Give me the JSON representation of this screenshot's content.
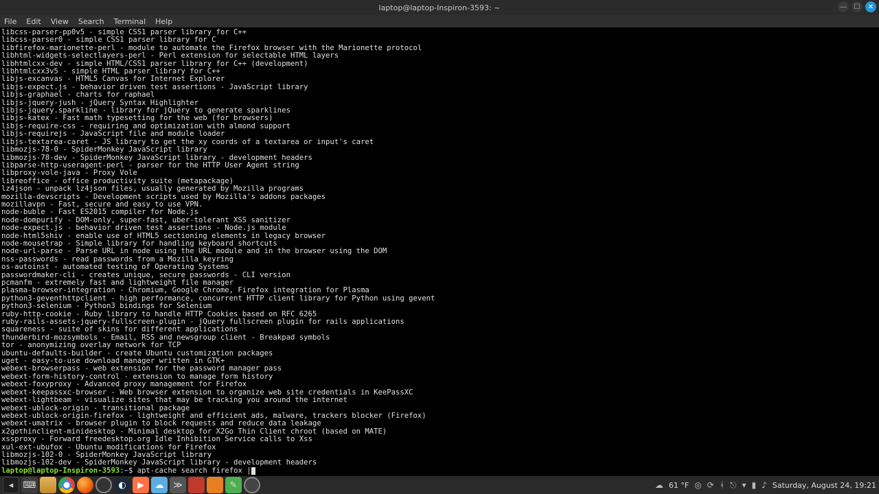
{
  "window": {
    "title": "laptop@laptop-Inspiron-3593: ~"
  },
  "menu": {
    "file": "File",
    "edit": "Edit",
    "view": "View",
    "search": "Search",
    "terminal": "Terminal",
    "help": "Help"
  },
  "terminal": {
    "lines": [
      "libcss-parser-pp0v5 - simple CSS1 parser library for C++",
      "libcss-parser0 - simple CSS1 parser library for C",
      "libfirefox-marionette-perl - module to automate the Firefox browser with the Marionette protocol",
      "libhtml-widgets-selectlayers-perl - Perl extension for selectable HTML layers",
      "libhtmlcxx-dev - simple HTML/CSS1 parser library for C++ (development)",
      "libhtmlcxx3v5 - simple HTML parser library for C++",
      "libjs-excanvas - HTML5 Canvas for Internet Explorer",
      "libjs-expect.js - behavior driven test assertions - JavaScript library",
      "libjs-graphael - charts for raphael",
      "libjs-jquery-jush - jQuery Syntax Highlighter",
      "libjs-jquery.sparkline - library for jQuery to generate sparklines",
      "libjs-katex - Fast math typesetting for the web (for browsers)",
      "libjs-require-css - requiring and optimization with almond support",
      "libjs-requirejs - JavaScript file and module loader",
      "libjs-textarea-caret - JS library to get the xy coords of a textarea or input's caret",
      "libmozjs-78-0 - SpiderMonkey JavaScript library",
      "libmozjs-78-dev - SpiderMonkey JavaScript library - development headers",
      "libparse-http-useragent-perl - parser for the HTTP User Agent string",
      "libproxy-vole-java - Proxy Vole",
      "libreoffice - office productivity suite (metapackage)",
      "lz4json - unpack lz4json files, usually generated by Mozilla programs",
      "mozilla-devscripts - Development scripts used by Mozilla's addons packages",
      "mozillavpn - Fast, secure and easy to use VPN.",
      "node-buble - Fast ES2015 compiler for Node.js",
      "node-dompurify - DOM-only, super-fast, uber-tolerant XSS sanitizer",
      "node-expect.js - behavior driven test assertions - Node.js module",
      "node-html5shiv - enable use of HTML5 sectioning elements in legacy browser",
      "node-mousetrap - Simple library for handling keyboard shortcuts",
      "node-url-parse - Parse URL in node using the URL module and in the browser using the DOM",
      "nss-passwords - read passwords from a Mozilla keyring",
      "os-autoinst - automated testing of Operating Systems",
      "passwordmaker-cli - creates unique, secure passwords - CLI version",
      "pcmanfm - extremely fast and lightweight file manager",
      "plasma-browser-integration - Chromium, Google Chrome, Firefox integration for Plasma",
      "python3-geventhttpclient - high performance, concurrent HTTP client library for Python using gevent",
      "python3-selenium - Python3 bindings for Selenium",
      "ruby-http-cookie - Ruby library to handle HTTP Cookies based on RFC 6265",
      "ruby-rails-assets-jquery-fullscreen-plugin - jQuery fullscreen plugin for rails applications",
      "squareness - suite of skins for different applications",
      "thunderbird-mozsymbols - Email, RSS and newsgroup client - Breakpad symbols",
      "tor - anonymizing overlay network for TCP",
      "ubuntu-defaults-builder - create Ubuntu customization packages",
      "uget - easy-to-use download manager written in GTK+",
      "webext-browserpass - web extension for the password manager pass",
      "webext-form-history-control - extension to manage form history",
      "webext-foxyproxy - Advanced proxy management for Firefox",
      "webext-keepassxc-browser - Web browser extension to organize web site credentials in KeePassXC",
      "webext-lightbeam - visualize sites that may be tracking you around the internet",
      "webext-ublock-origin - transitional package",
      "webext-ublock-origin-firefox - lightweight and efficient ads, malware, trackers blocker (Firefox)",
      "webext-umatrix - browser plugin to block requests and reduce data leakage",
      "x2gothinclient-minidesktop - Minimal desktop for X2Go Thin Client chroot (based on MATE)",
      "xssproxy - Forward freedesktop.org Idle Inhibition Service calls to Xss",
      "xul-ext-ubufox - Ubuntu modifications for Firefox",
      "libmozjs-102-0 - SpiderMonkey JavaScript library",
      "libmozjs-102-dev - SpiderMonkey JavaScript library - development headers"
    ],
    "prompt_user": "laptop@laptop-Inspiron-3593",
    "prompt_sep": ":",
    "prompt_path": "~",
    "prompt_dollar": "$ ",
    "command": "apt-cache search firefox |"
  },
  "taskbar": {
    "weather": "61 °F",
    "clock": "Saturday, August 24, 19:21"
  }
}
